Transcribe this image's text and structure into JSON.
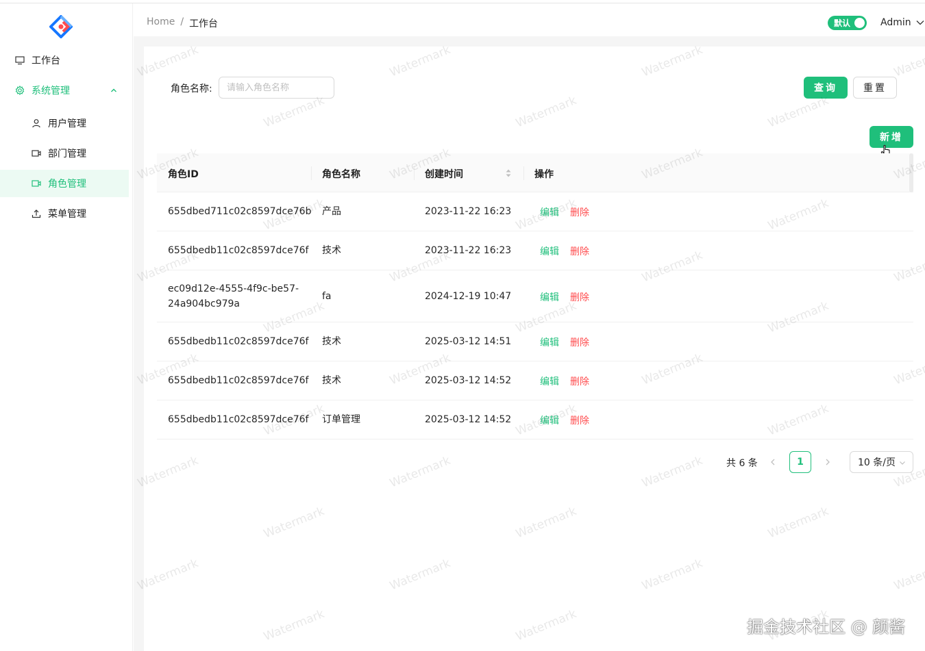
{
  "colors": {
    "accent": "#1fbf7b",
    "danger": "#ff4d4f"
  },
  "sidebar": {
    "logo_icon": "diamond-logo-icon",
    "items": [
      {
        "label": "工作台",
        "icon": "monitor-icon"
      },
      {
        "label": "系统管理",
        "icon": "gear-icon"
      },
      {
        "label": "用户管理",
        "icon": "user-icon"
      },
      {
        "label": "部门管理",
        "icon": "video-icon"
      },
      {
        "label": "角色管理",
        "icon": "video-icon"
      },
      {
        "label": "菜单管理",
        "icon": "upload-icon"
      }
    ]
  },
  "header": {
    "breadcrumb": {
      "home": "Home",
      "sep": "/",
      "current": "工作台"
    },
    "toggle_label": "默认",
    "user": "Admin"
  },
  "search": {
    "label": "角色名称:",
    "placeholder": "请输入角色名称",
    "query_label": "查询",
    "reset_label": "重置"
  },
  "add_label": "新增",
  "table": {
    "columns": [
      "角色ID",
      "角色名称",
      "创建时间",
      "操作"
    ],
    "rows": [
      {
        "id": "655dbed711c02c8597dce76b",
        "name": "产品",
        "time": "2023-11-22 16:23"
      },
      {
        "id": "655dbedb11c02c8597dce76f",
        "name": "技术",
        "time": "2023-11-22 16:23"
      },
      {
        "id_line1": "ec09d12e-4555-4f9c-be57-",
        "id_line2": "24a904bc979a",
        "name": "fa",
        "time": "2024-12-19 10:47"
      },
      {
        "id": "655dbedb11c02c8597dce76f",
        "name": "技术",
        "time": "2025-03-12 14:51"
      },
      {
        "id": "655dbedb11c02c8597dce76f",
        "name": "技术",
        "time": "2025-03-12 14:52"
      },
      {
        "id": "655dbedb11c02c8597dce76f",
        "name": "订单管理",
        "time": "2025-03-12 14:52"
      }
    ],
    "edit_label": "编辑",
    "delete_label": "删除"
  },
  "pagination": {
    "total": "共 6 条",
    "current": "1",
    "page_size": "10 条/页"
  },
  "watermark": "Watermark",
  "signature": "掘金技术社区 @ 颜酱"
}
